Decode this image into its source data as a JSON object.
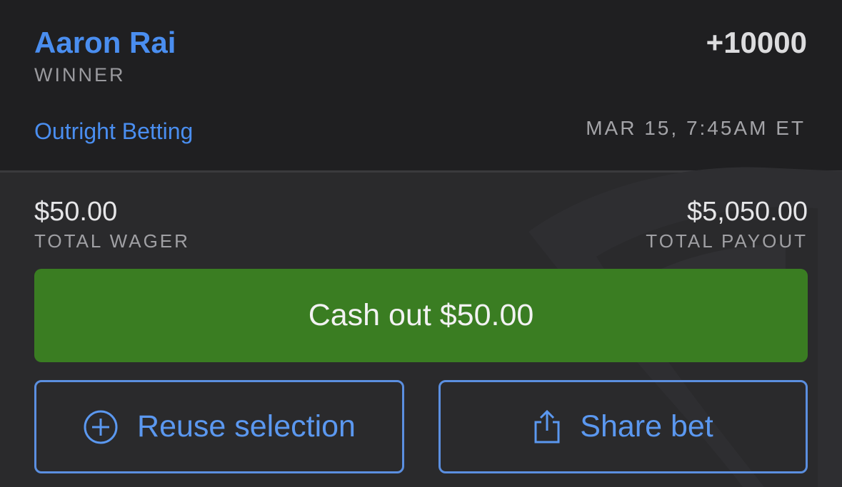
{
  "bet": {
    "selection": "Aaron Rai",
    "odds": "+10000",
    "market": "WINNER",
    "event_link": "Outright Betting",
    "datetime": "MAR 15, 7:45AM ET"
  },
  "summary": {
    "wager_amount": "$50.00",
    "wager_label": "TOTAL WAGER",
    "payout_amount": "$5,050.00",
    "payout_label": "TOTAL PAYOUT"
  },
  "actions": {
    "cashout_label": "Cash out $50.00",
    "reuse_label": "Reuse selection",
    "reuse_icon": "plus-circle-icon",
    "share_label": "Share bet",
    "share_icon": "share-icon"
  },
  "colors": {
    "accent_blue": "#4a8ef0",
    "cashout_green": "#3a7d22",
    "background_dark": "#1f1f21",
    "background_card": "#2a2a2c"
  }
}
